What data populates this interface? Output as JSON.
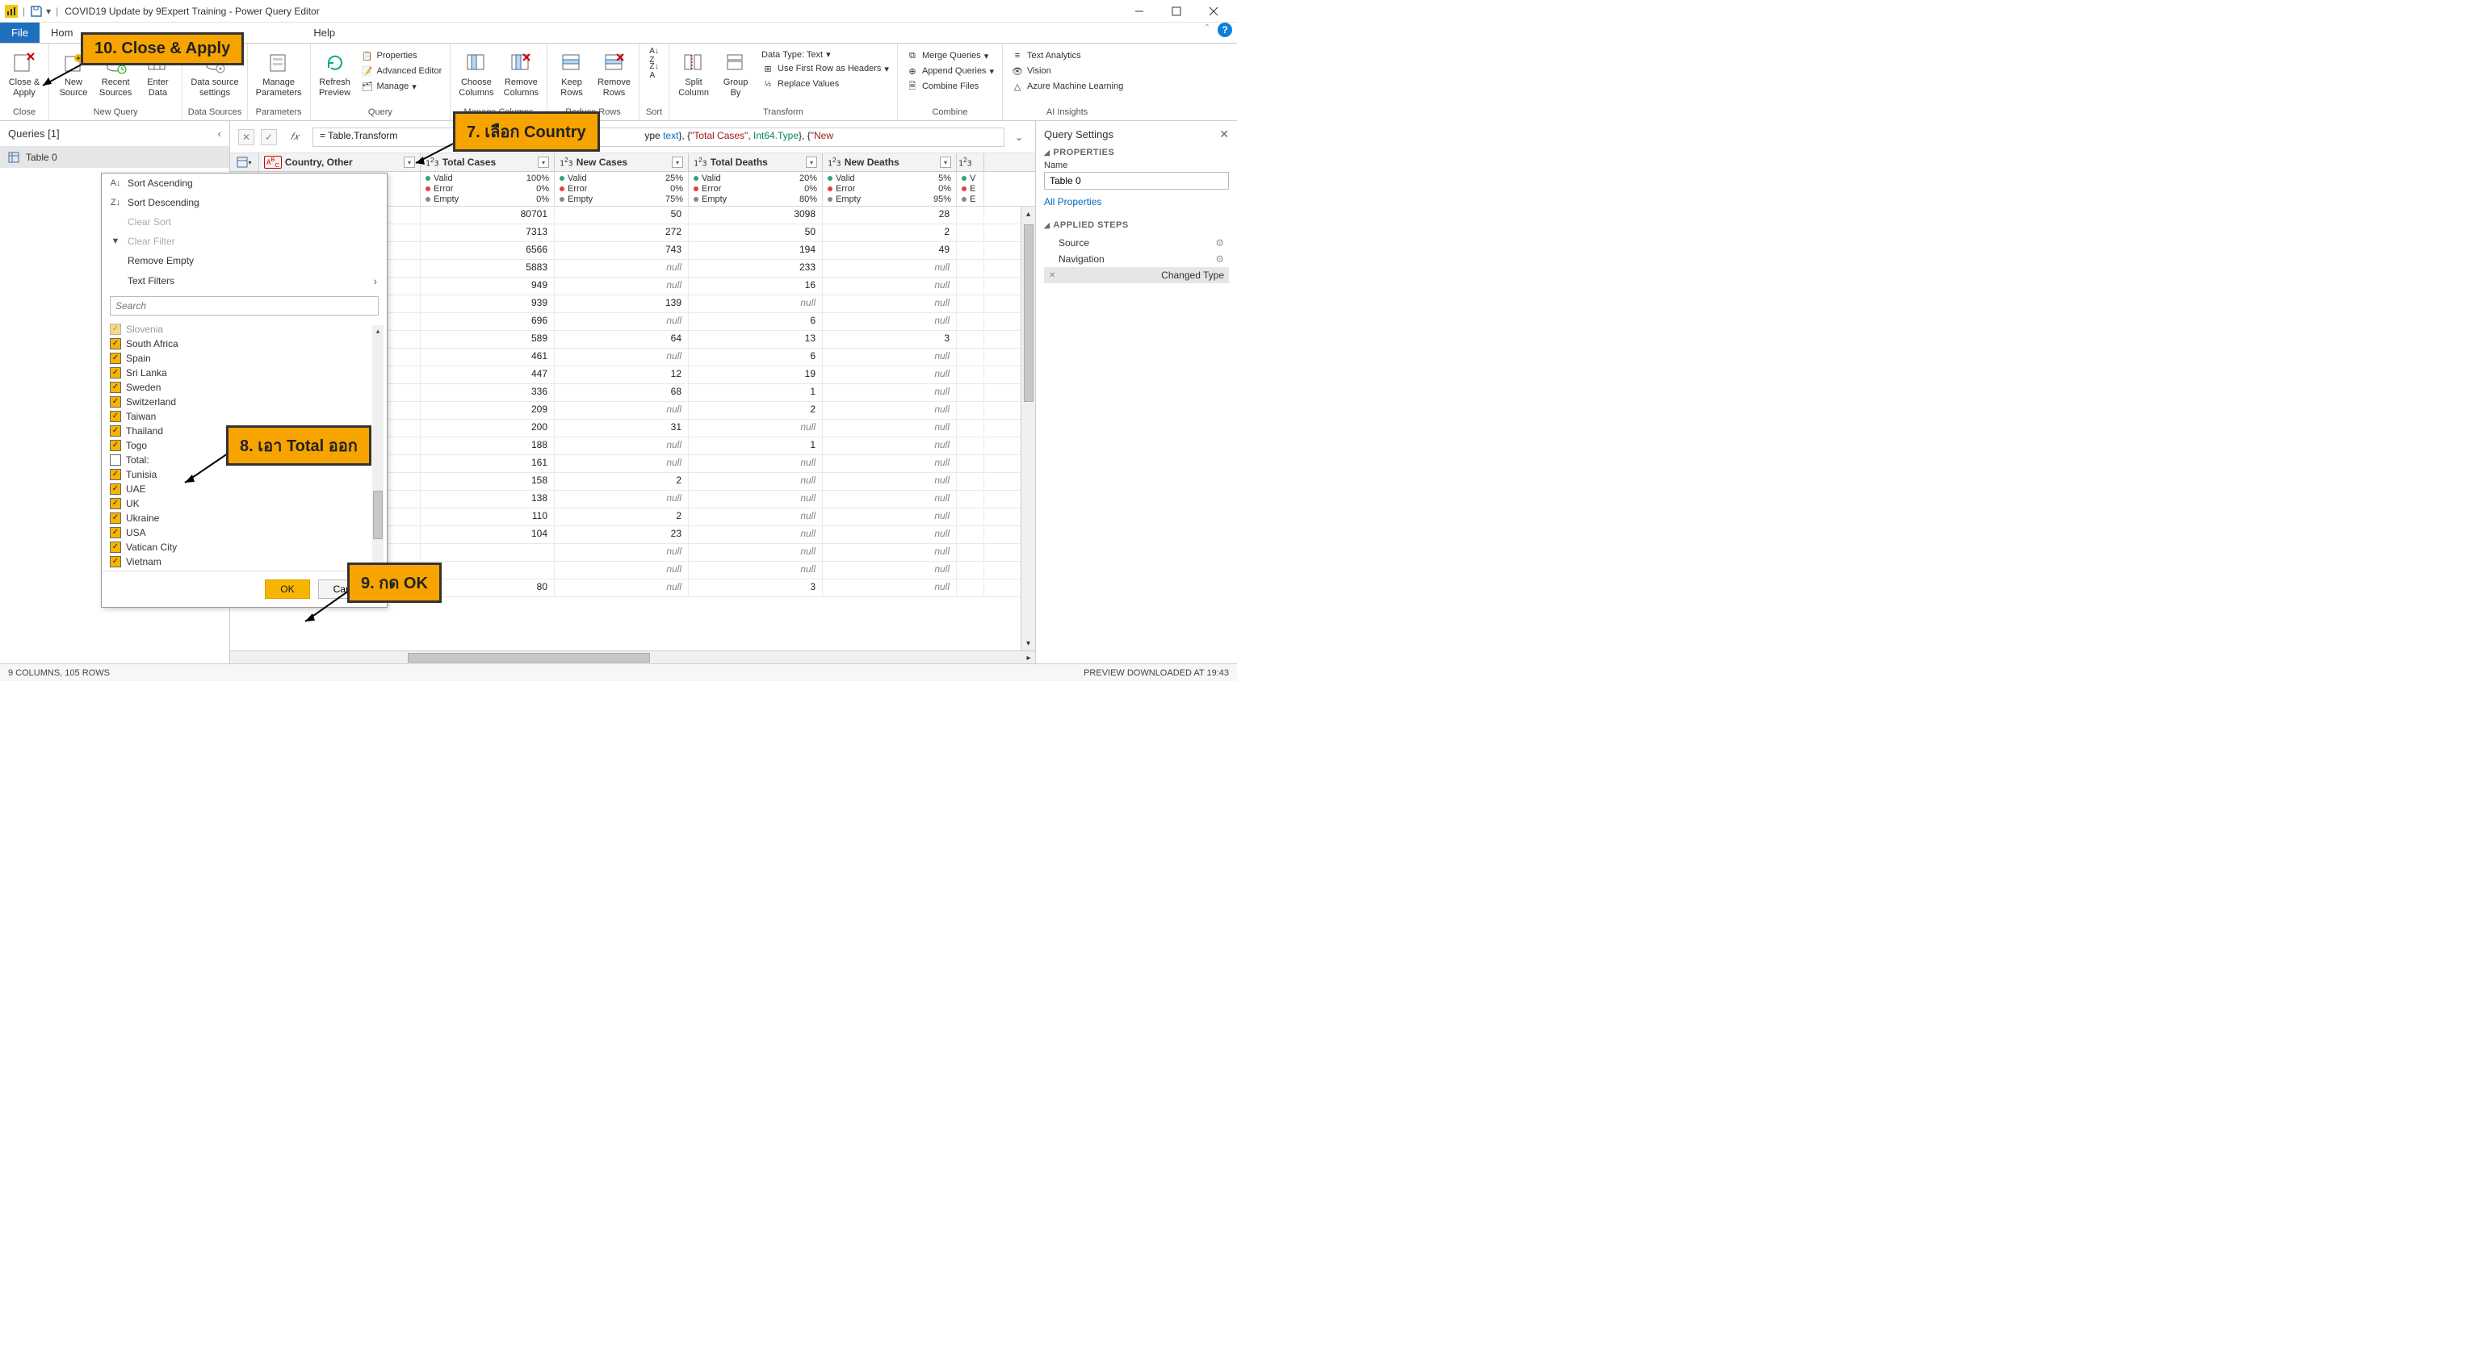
{
  "titlebar": {
    "title": "COVID19 Update by 9Expert Training - Power Query Editor"
  },
  "menubar": {
    "file": "File",
    "home": "Hom",
    "help": "Help"
  },
  "ribbon": {
    "close": {
      "label": "Close &\nApply",
      "group": "Close"
    },
    "newSource": "New\nSource",
    "recentSources": "Recent\nSources",
    "enterData": "Enter\nData",
    "newQuery": "New Query",
    "dsSettings": "Data source\nsettings",
    "dataSources": "Data Sources",
    "manageParams": "Manage\nParameters",
    "parameters": "Parameters",
    "refreshPreview": "Refresh\nPreview",
    "properties": "Properties",
    "advEditor": "Advanced Editor",
    "manage": "Manage",
    "query": "Query",
    "chooseCols": "Choose\nColumns",
    "removeCols": "Remove\nColumns",
    "manageCols": "Manage Columns",
    "keepRows": "Keep\nRows",
    "removeRows": "Remove\nRows",
    "reduceRows": "Reduce Rows",
    "sort": "Sort",
    "splitCol": "Split\nColumn",
    "groupBy": "Group\nBy",
    "dataType": "Data Type: Text",
    "firstRow": "Use First Row as Headers",
    "replaceVals": "Replace Values",
    "transform": "Transform",
    "mergeQ": "Merge Queries",
    "appendQ": "Append Queries",
    "combineFiles": "Combine Files",
    "combine": "Combine",
    "textAnalytics": "Text Analytics",
    "vision": "Vision",
    "azureML": "Azure Machine Learning",
    "aiInsights": "AI Insights"
  },
  "queriesPanel": {
    "header": "Queries [1]",
    "item": "Table 0"
  },
  "formulaBar": {
    "prefix": "= Table.Transform",
    "mid1": "ype ",
    "type1": "text",
    "mid2": "}, {",
    "str1": "\"Total Cases\"",
    "mid3": ", ",
    "type2": "Int64.Type",
    "mid4": "}, {",
    "str2": "\"New"
  },
  "columns": {
    "c0": "Country, Other",
    "c1": "Total Cases",
    "c2": "New Cases",
    "c3": "Total Deaths",
    "c4": "New Deaths",
    "quality": {
      "valid": "Valid",
      "error": "Error",
      "empty": "Empty",
      "c1": {
        "valid": "100%",
        "error": "0%",
        "empty": "0%"
      },
      "c2": {
        "valid": "25%",
        "error": "0%",
        "empty": "75%"
      },
      "c3": {
        "valid": "20%",
        "error": "0%",
        "empty": "80%"
      },
      "c4": {
        "valid": "5%",
        "error": "0%",
        "empty": "95%"
      },
      "c5": {
        "valid": "V",
        "error": "E",
        "empty": "E"
      }
    }
  },
  "rows": [
    {
      "c1": "80701",
      "c2": "50",
      "c3": "3098",
      "c4": "28"
    },
    {
      "c1": "7313",
      "c2": "272",
      "c3": "50",
      "c4": "2"
    },
    {
      "c1": "6566",
      "c2": "743",
      "c3": "194",
      "c4": "49"
    },
    {
      "c1": "5883",
      "c2": "null",
      "c3": "233",
      "c4": "null"
    },
    {
      "c1": "949",
      "c2": "null",
      "c3": "16",
      "c4": "null"
    },
    {
      "c1": "939",
      "c2": "139",
      "c3": "null",
      "c4": "null"
    },
    {
      "c1": "696",
      "c2": "null",
      "c3": "6",
      "c4": "null"
    },
    {
      "c1": "589",
      "c2": "64",
      "c3": "13",
      "c4": "3"
    },
    {
      "c1": "461",
      "c2": "null",
      "c3": "6",
      "c4": "null"
    },
    {
      "c1": "447",
      "c2": "12",
      "c3": "19",
      "c4": "null"
    },
    {
      "c1": "336",
      "c2": "68",
      "c3": "1",
      "c4": "null"
    },
    {
      "c1": "209",
      "c2": "null",
      "c3": "2",
      "c4": "null"
    },
    {
      "c1": "200",
      "c2": "31",
      "c3": "null",
      "c4": "null"
    },
    {
      "c1": "188",
      "c2": "null",
      "c3": "1",
      "c4": "null"
    },
    {
      "c1": "161",
      "c2": "null",
      "c3": "null",
      "c4": "null"
    },
    {
      "c1": "158",
      "c2": "2",
      "c3": "null",
      "c4": "null"
    },
    {
      "c1": "138",
      "c2": "null",
      "c3": "null",
      "c4": "null"
    },
    {
      "c1": "110",
      "c2": "2",
      "c3": "null",
      "c4": "null"
    },
    {
      "c1": "104",
      "c2": "23",
      "c3": "null",
      "c4": "null"
    },
    {
      "c1": "",
      "c2": "null",
      "c3": "null",
      "c4": "null"
    },
    {
      "c1": "",
      "c2": "null",
      "c3": "null",
      "c4": "null"
    },
    {
      "c1": "80",
      "c2": "null",
      "c3": "3",
      "c4": "null"
    }
  ],
  "filterPopup": {
    "sortAsc": "Sort Ascending",
    "sortDesc": "Sort Descending",
    "clearSort": "Clear Sort",
    "clearFilter": "Clear Filter",
    "removeEmpty": "Remove Empty",
    "textFilters": "Text Filters",
    "searchPlaceholder": "Search",
    "items": [
      {
        "label": "Slovenia",
        "checked": true
      },
      {
        "label": "South Africa",
        "checked": true
      },
      {
        "label": "Spain",
        "checked": true
      },
      {
        "label": "Sri Lanka",
        "checked": true
      },
      {
        "label": "Sweden",
        "checked": true
      },
      {
        "label": "Switzerland",
        "checked": true
      },
      {
        "label": "Taiwan",
        "checked": true
      },
      {
        "label": "Thailand",
        "checked": true
      },
      {
        "label": "Togo",
        "checked": true
      },
      {
        "label": "Total:",
        "checked": false
      },
      {
        "label": "Tunisia",
        "checked": true
      },
      {
        "label": "UAE",
        "checked": true
      },
      {
        "label": "UK",
        "checked": true
      },
      {
        "label": "Ukraine",
        "checked": true
      },
      {
        "label": "USA",
        "checked": true
      },
      {
        "label": "Vatican City",
        "checked": true
      },
      {
        "label": "Vietnam",
        "checked": true
      }
    ],
    "ok": "OK",
    "cancel": "Cancel"
  },
  "settings": {
    "header": "Query Settings",
    "properties": "PROPERTIES",
    "nameLabel": "Name",
    "nameValue": "Table 0",
    "allProps": "All Properties",
    "appliedSteps": "APPLIED STEPS",
    "steps": [
      {
        "label": "Source",
        "gear": true
      },
      {
        "label": "Navigation",
        "gear": true
      },
      {
        "label": "Changed Type",
        "gear": false,
        "selected": true
      }
    ]
  },
  "statusbar": {
    "left": "9 COLUMNS, 105 ROWS",
    "right": "PREVIEW DOWNLOADED AT 19:43"
  },
  "callouts": {
    "c7": "7. เลือก Country",
    "c8": "8. เอา Total ออก",
    "c9": "9. กด OK",
    "c10": "10. Close & Apply"
  }
}
